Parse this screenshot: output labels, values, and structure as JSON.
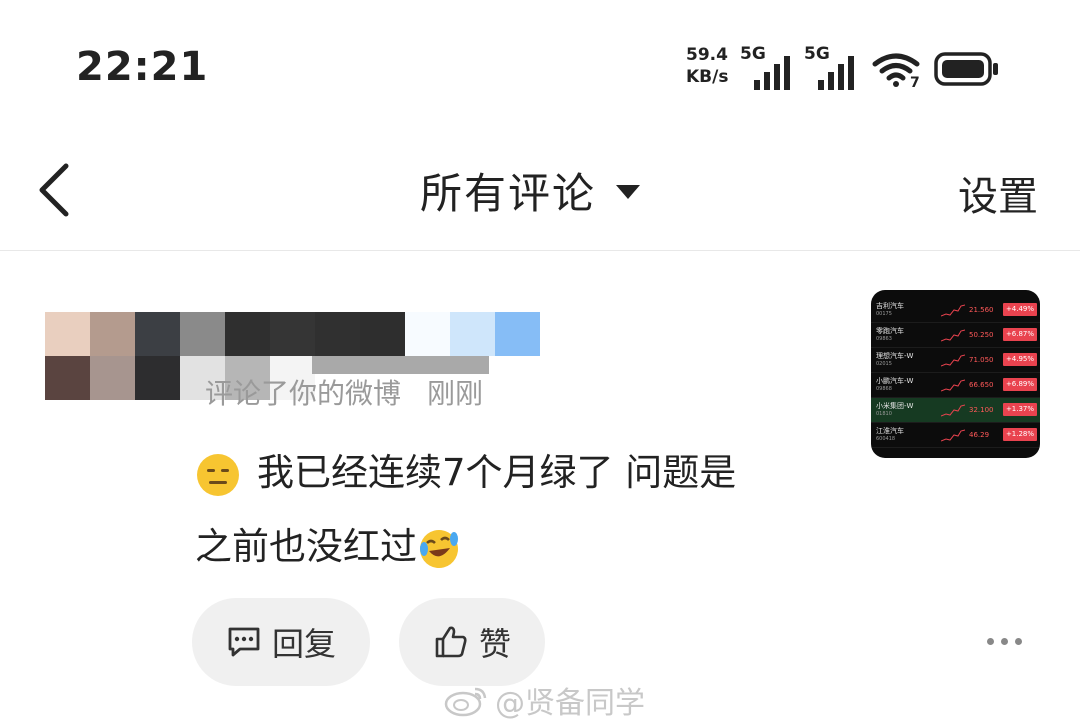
{
  "status_bar": {
    "time": "22:21",
    "net_speed_value": "59.4",
    "net_speed_unit": "KB/s",
    "sim1_type": "5G",
    "sim2_type": "5G",
    "wifi_badge": "7"
  },
  "nav": {
    "title": "所有评论",
    "settings_label": "设置"
  },
  "comment": {
    "meta_action": "评论了你的微博",
    "meta_time": "刚刚",
    "text_line1": "我已经连续7个月绿了 问题是",
    "text_line2": "之前也没红过",
    "reply_label": "回复",
    "like_label": "赞"
  },
  "thumbnail": {
    "rows": [
      {
        "name": "吉利汽车",
        "code": "00175",
        "price": "21.560",
        "change": "+4.49%"
      },
      {
        "name": "零跑汽车",
        "code": "09863",
        "price": "50.250",
        "change": "+6.87%"
      },
      {
        "name": "理想汽车-W",
        "code": "02015",
        "price": "71.050",
        "change": "+4.95%"
      },
      {
        "name": "小鹏汽车-W",
        "code": "09868",
        "price": "66.650",
        "change": "+6.89%"
      },
      {
        "name": "小米集团-W",
        "code": "01810",
        "price": "32.100",
        "change": "+1.37%"
      },
      {
        "name": "江淮汽车",
        "code": "600418",
        "price": "46.29",
        "change": "+1.28%"
      }
    ]
  },
  "watermark": {
    "text": "@贤备同学"
  },
  "colors": {
    "background": "#ffffff",
    "text_primary": "#222222",
    "text_secondary": "#9a9a9a",
    "pill_bg": "#f0f0f0",
    "stock_up": "#e9434f"
  },
  "icons": {
    "back": "chevron-left-icon",
    "dropdown": "caret-down-icon",
    "emoji_1": "expressionless-emoji-icon",
    "emoji_2": "laughing-crying-emoji-icon",
    "reply": "comment-bubble-icon",
    "like": "thumbs-up-icon",
    "more": "more-dots-icon",
    "watermark": "weibo-logo-icon"
  }
}
